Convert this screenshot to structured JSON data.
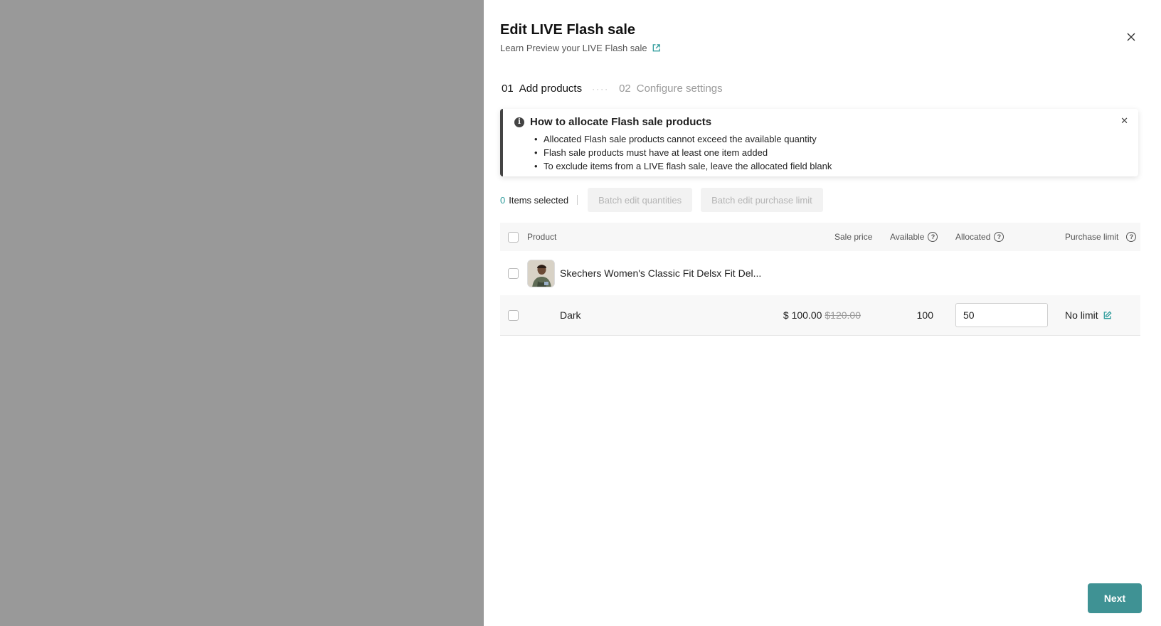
{
  "drawer": {
    "title": "Edit LIVE Flash sale",
    "subtitle": "Learn Preview your LIVE Flash sale"
  },
  "steps": [
    {
      "num": "01",
      "label": "Add products",
      "state": "active"
    },
    {
      "num": "02",
      "label": "Configure settings",
      "state": "inactive"
    }
  ],
  "info": {
    "title": "How to allocate Flash sale products",
    "items": [
      "Allocated Flash sale products cannot exceed the available quantity",
      "Flash sale products must have at least one item added",
      "To exclude items from a LIVE flash sale, leave the allocated field blank"
    ]
  },
  "toolbar": {
    "count": "0",
    "count_label": "Items selected",
    "batch_quantities": "Batch edit quantities",
    "batch_limit": "Batch edit purchase limit"
  },
  "table": {
    "headers": {
      "product": "Product",
      "sale_price": "Sale price",
      "available": "Available",
      "allocated": "Allocated",
      "purchase_limit": "Purchase limit"
    },
    "product": {
      "name": "Skechers Women's Classic Fit Delsx Fit Del..."
    },
    "variant": {
      "name": "Dark",
      "sale_price": "$ 100.00",
      "original_price": "$120.00",
      "available": "100",
      "allocated": "50",
      "purchase_limit": "No limit"
    }
  },
  "footer": {
    "next": "Next"
  },
  "colors": {
    "accent": "#2f9c9c",
    "primary_button": "#3f9294",
    "overlay": "#999999"
  }
}
